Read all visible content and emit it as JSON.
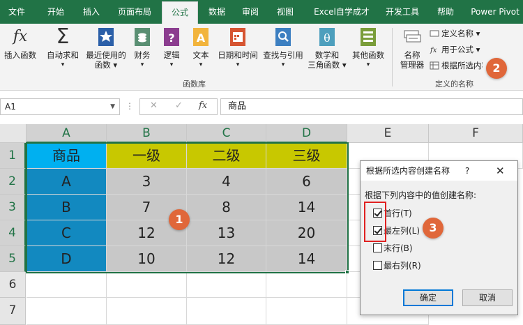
{
  "tabs": [
    "文件",
    "开始",
    "插入",
    "页面布局",
    "公式",
    "数据",
    "审阅",
    "视图",
    "Excel自学成才",
    "开发工具",
    "帮助",
    "Power Pivot"
  ],
  "active_tab": "公式",
  "ribbon": {
    "insert_function": "插入函数",
    "autosum": [
      "自动求和",
      "▾"
    ],
    "recent": [
      "最近使用的",
      "函数 ▾"
    ],
    "finance": [
      "财务",
      "▾"
    ],
    "logic": [
      "逻辑",
      "▾"
    ],
    "text": [
      "文本",
      "▾"
    ],
    "datetime": [
      "日期和时间",
      "▾"
    ],
    "lookup": [
      "查找与引用",
      "▾"
    ],
    "math": [
      "数学和",
      "三角函数 ▾"
    ],
    "more": [
      "其他函数",
      "▾"
    ],
    "group_library": "函数库",
    "name_manager": [
      "名称",
      "管理器"
    ],
    "define_name": "定义名称 ▾",
    "use_in_formula": "用于公式 ▾",
    "create_from_selection": "根据所选内容创建",
    "group_names": "定义的名称",
    "fx_glyph": "fx",
    "sigma_glyph": "Σ"
  },
  "formula_bar": {
    "name_box": "A1",
    "cancel": "✕",
    "enter": "✓",
    "fx": "fx",
    "content": "商品"
  },
  "sheet": {
    "columns": [
      "A",
      "B",
      "C",
      "D",
      "E",
      "F"
    ],
    "rows": [
      "1",
      "2",
      "3",
      "4",
      "5",
      "6",
      "7"
    ],
    "cells": [
      [
        "商品",
        "一级",
        "二级",
        "三级"
      ],
      [
        "A",
        "3",
        "4",
        "6"
      ],
      [
        "B",
        "7",
        "8",
        "14"
      ],
      [
        "C",
        "12",
        "13",
        "20"
      ],
      [
        "D",
        "10",
        "12",
        "14"
      ]
    ]
  },
  "dialog": {
    "title": "根据所选内容创建名称",
    "help": "?",
    "close": "✕",
    "prompt": "根据下列内容中的值创建名称:",
    "options": [
      {
        "label": "首行(T)",
        "checked": true
      },
      {
        "label": "最左列(L)",
        "checked": true
      },
      {
        "label": "末行(B)",
        "checked": false
      },
      {
        "label": "最右列(R)",
        "checked": false
      }
    ],
    "ok": "确定",
    "cancel": "取消"
  },
  "badges": [
    "1",
    "2",
    "3"
  ],
  "colors": {
    "excel_green": "#217346",
    "header_cyan": "#00b0f0",
    "header_olive": "#c8c800",
    "col_a_blue": "#1289c0",
    "data_gray": "#c8c8c8",
    "badge": "#e0673a",
    "highlight_red": "#e02020"
  }
}
